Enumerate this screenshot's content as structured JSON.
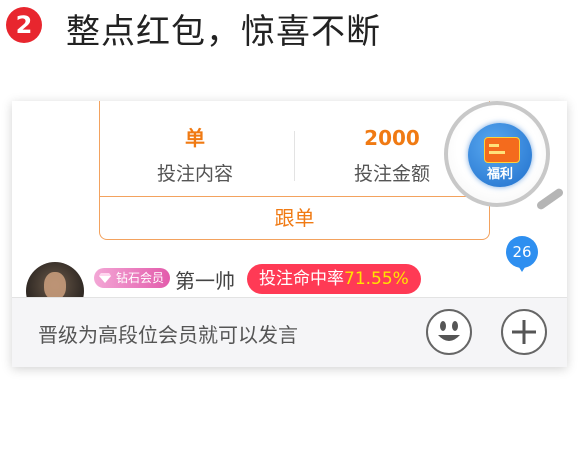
{
  "headline": {
    "step": "2",
    "text": "整点红包，惊喜不断"
  },
  "bet_card": {
    "content_value": "单",
    "content_label": "投注内容",
    "amount_value": "2000",
    "amount_label": "投注金额",
    "follow_label": "跟单"
  },
  "welfare": {
    "label": "福利"
  },
  "message_count": "26",
  "user": {
    "vip_label": "钻石会员",
    "name": "第一帅",
    "hit_rate_label": "投注命中率",
    "hit_rate_value": "71.55%"
  },
  "input": {
    "placeholder": "晋级为高段位会员就可以发言"
  },
  "colors": {
    "accent": "#f07a13",
    "badge_red": "#e8262e",
    "hit_rate_bg": "#ff3a55",
    "count_blue": "#2e8ff0"
  }
}
